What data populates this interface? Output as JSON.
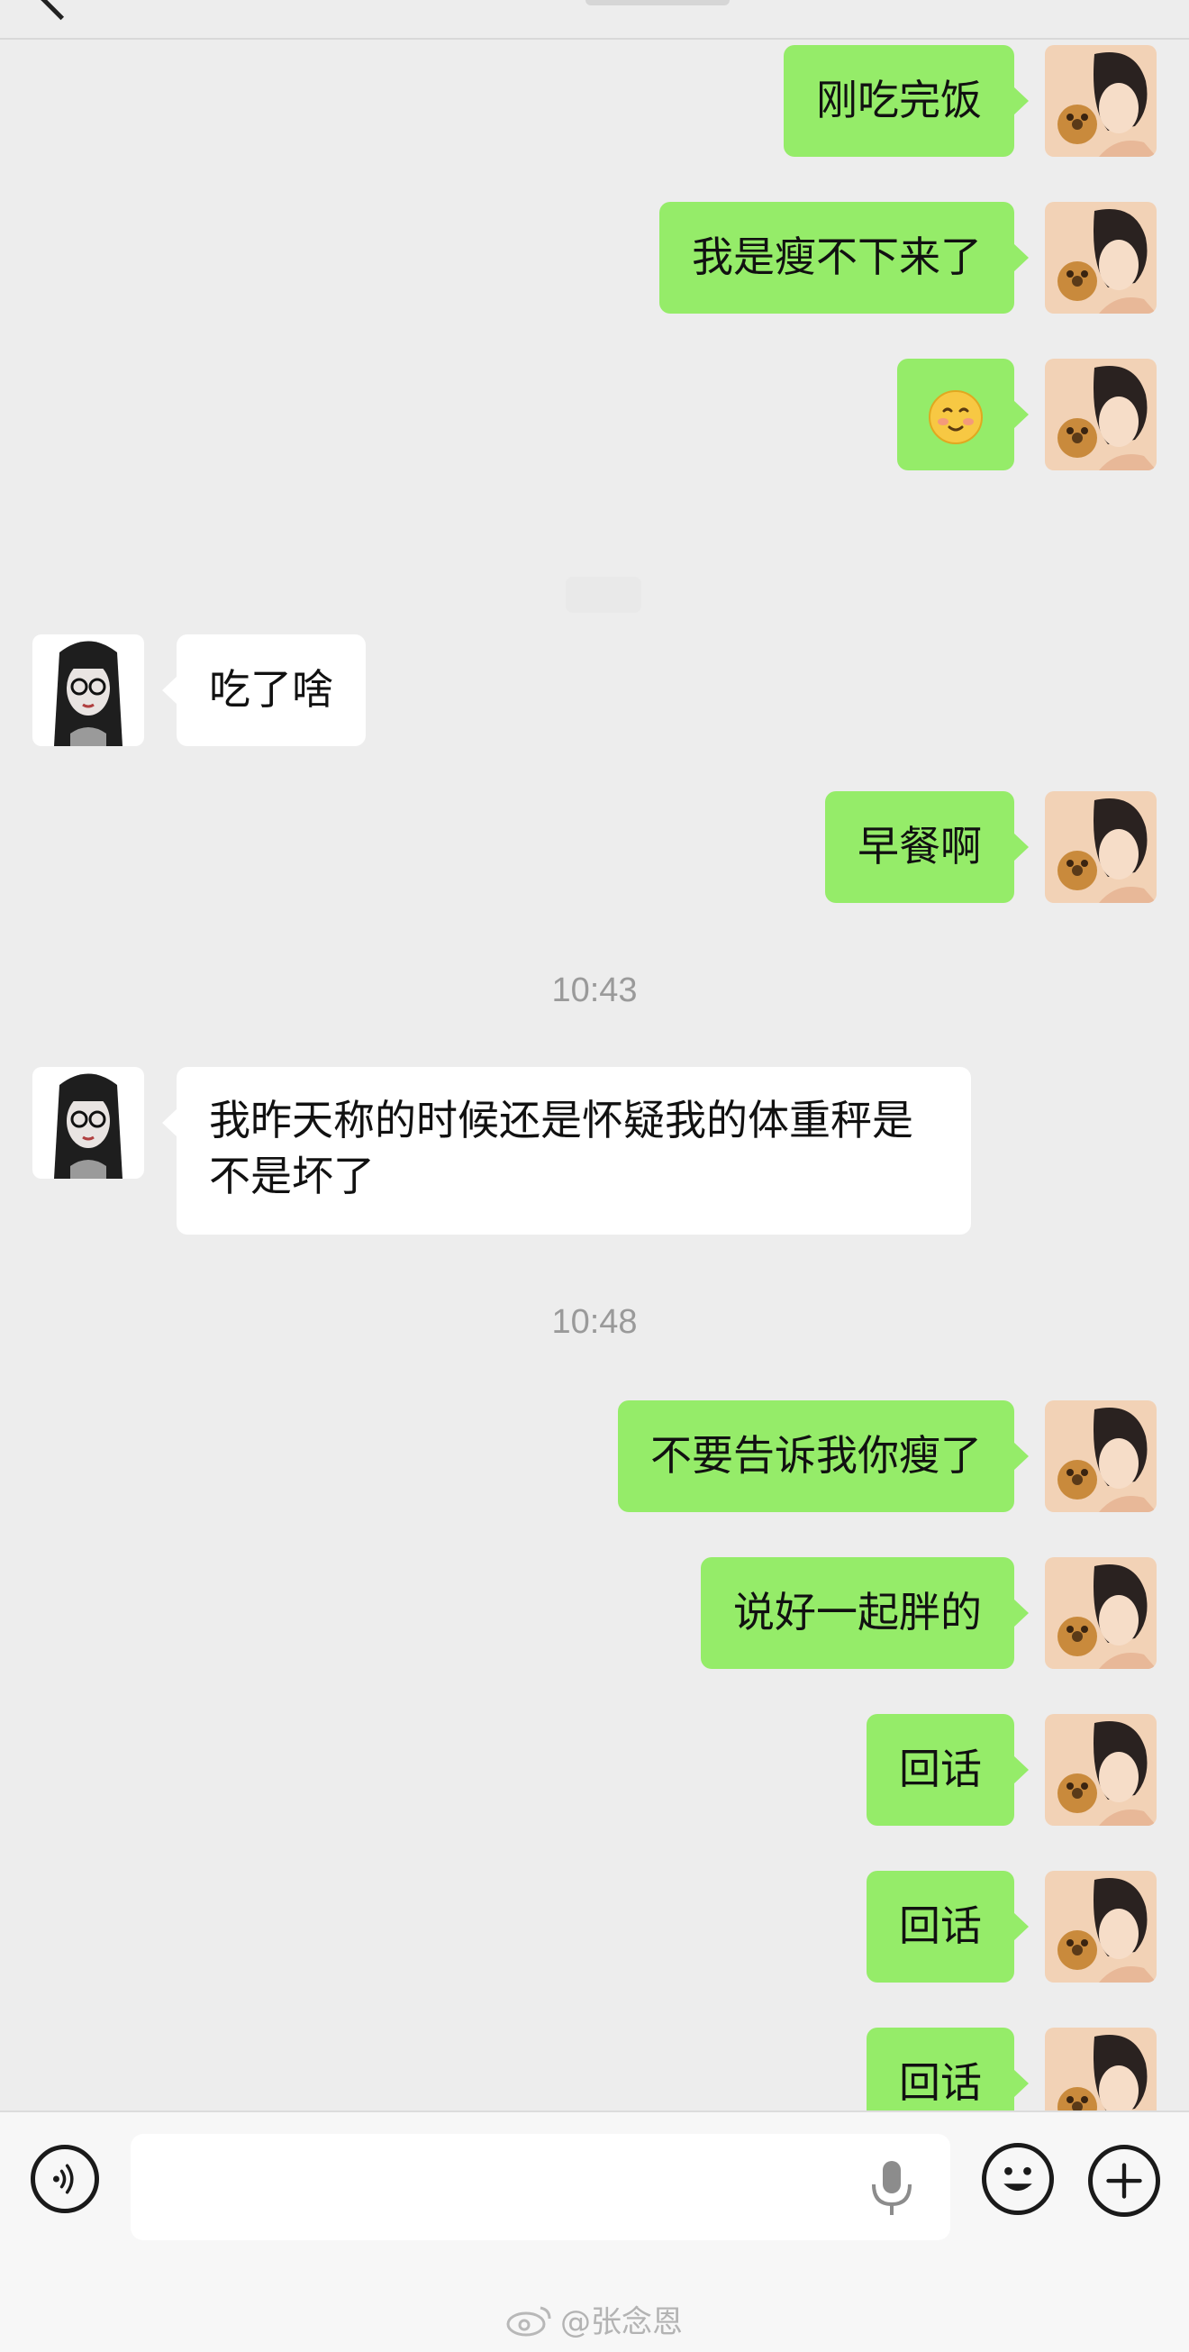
{
  "messages": [
    {
      "dir": "out",
      "text": "刚吃完饭"
    },
    {
      "dir": "out",
      "text": "我是瘦不下来了"
    },
    {
      "dir": "out",
      "text": "",
      "emoji": "smiling-face-emoji"
    },
    {
      "dir": "in",
      "text": "吃了啥"
    },
    {
      "dir": "out",
      "text": "早餐啊"
    },
    {
      "time": "10:43"
    },
    {
      "dir": "in",
      "text": "我昨天称的时候还是怀疑我的体重秤是不是坏了"
    },
    {
      "time": "10:48"
    },
    {
      "dir": "out",
      "text": "不要告诉我你瘦了"
    },
    {
      "dir": "out",
      "text": "说好一起胖的"
    },
    {
      "dir": "out",
      "text": "回话"
    },
    {
      "dir": "out",
      "text": "回话"
    },
    {
      "dir": "out",
      "text": "回话"
    }
  ],
  "input": {
    "value": "",
    "placeholder": ""
  },
  "icons": {
    "voice": "voice-mode-icon",
    "mic": "microphone-icon",
    "emoji": "emoji-icon",
    "plus": "plus-icon",
    "weibo": "weibo-icon"
  },
  "watermark": {
    "text": "@张念恩"
  },
  "colors": {
    "outgoing_bubble": "#95ec69",
    "incoming_bubble": "#ffffff",
    "background": "#ededed"
  }
}
